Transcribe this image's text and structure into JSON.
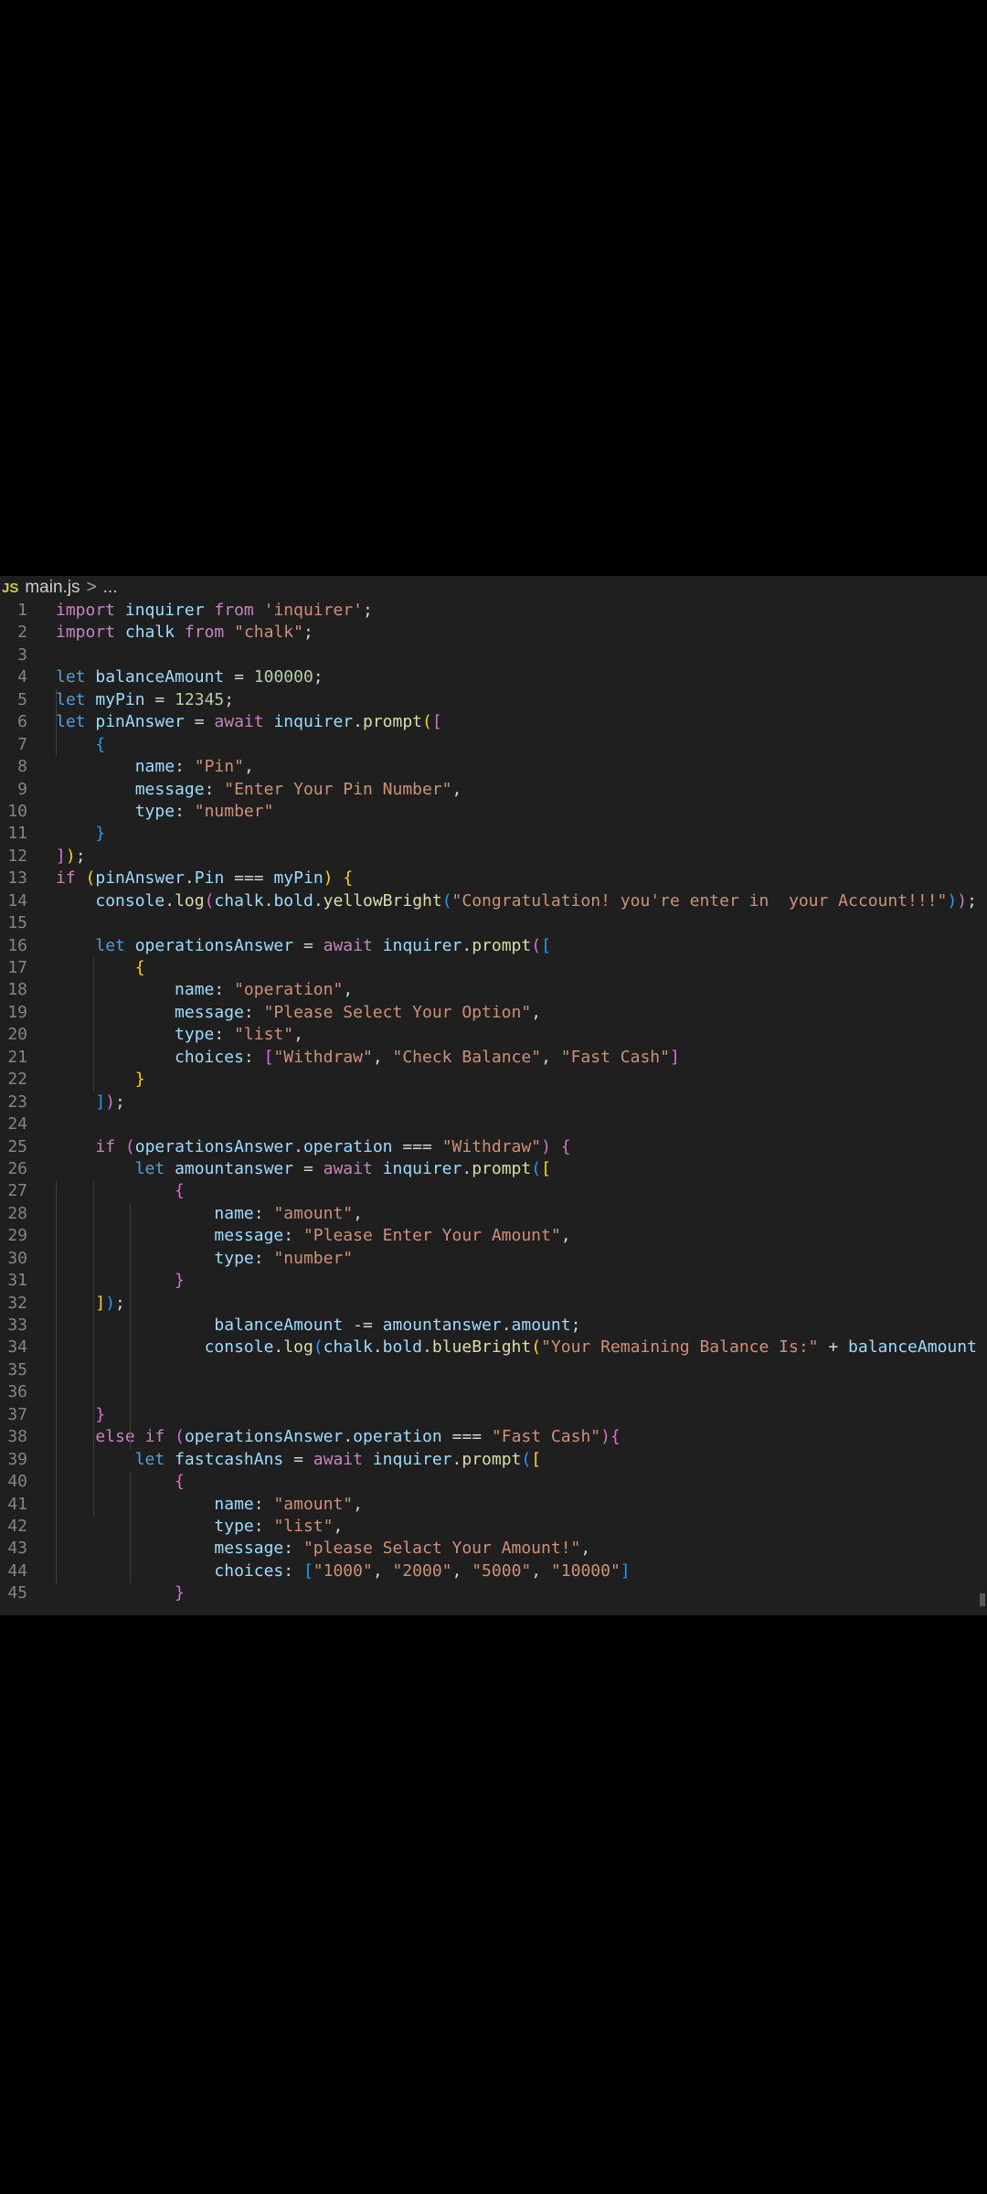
{
  "breadcrumb": {
    "file_badge": "JS",
    "file_name": "main.js",
    "separator": ">",
    "trailing": "..."
  },
  "colors": {
    "editor_background": "#1f1f1f",
    "line_number": "#858585",
    "keyword": "#569cd6",
    "control_keyword": "#c586c0",
    "variable": "#9cdcfe",
    "function": "#dcdcaa",
    "string": "#ce9178",
    "number": "#b5cea8"
  },
  "editor": {
    "lines": [
      {
        "n": "1",
        "tokens": [
          [
            "ctrl",
            "import"
          ],
          [
            "t",
            " "
          ],
          [
            "var",
            "inquirer"
          ],
          [
            "t",
            " "
          ],
          [
            "ctrl",
            "from"
          ],
          [
            "t",
            " "
          ],
          [
            "str",
            "'inquirer'"
          ],
          [
            "t",
            ";"
          ]
        ]
      },
      {
        "n": "2",
        "tokens": [
          [
            "ctrl",
            "import"
          ],
          [
            "t",
            " "
          ],
          [
            "var",
            "chalk"
          ],
          [
            "t",
            " "
          ],
          [
            "ctrl",
            "from"
          ],
          [
            "t",
            " "
          ],
          [
            "str",
            "\"chalk\""
          ],
          [
            "t",
            ";"
          ]
        ]
      },
      {
        "n": "3",
        "tokens": []
      },
      {
        "n": "4",
        "tokens": [
          [
            "kw",
            "let"
          ],
          [
            "t",
            " "
          ],
          [
            "var",
            "balanceAmount"
          ],
          [
            "t",
            " = "
          ],
          [
            "num",
            "100000"
          ],
          [
            "t",
            ";"
          ]
        ]
      },
      {
        "n": "5",
        "tokens": [
          [
            "kw",
            "let"
          ],
          [
            "t",
            " "
          ],
          [
            "var",
            "myPin"
          ],
          [
            "t",
            " = "
          ],
          [
            "num",
            "12345"
          ],
          [
            "t",
            ";"
          ]
        ]
      },
      {
        "n": "6",
        "tokens": [
          [
            "kw",
            "let"
          ],
          [
            "t",
            " "
          ],
          [
            "var",
            "pinAnswer"
          ],
          [
            "t",
            " = "
          ],
          [
            "ctrl",
            "await"
          ],
          [
            "t",
            " "
          ],
          [
            "var",
            "inquirer"
          ],
          [
            "t",
            "."
          ],
          [
            "fn",
            "prompt"
          ],
          [
            "b1",
            "("
          ],
          [
            "b2",
            "["
          ]
        ]
      },
      {
        "n": "7",
        "tokens": [
          [
            "t",
            "    "
          ],
          [
            "b3",
            "{"
          ]
        ]
      },
      {
        "n": "8",
        "tokens": [
          [
            "t",
            "        "
          ],
          [
            "var",
            "name"
          ],
          [
            "t",
            ": "
          ],
          [
            "str",
            "\"Pin\""
          ],
          [
            "t",
            ","
          ]
        ]
      },
      {
        "n": "9",
        "tokens": [
          [
            "t",
            "        "
          ],
          [
            "var",
            "message"
          ],
          [
            "t",
            ": "
          ],
          [
            "str",
            "\"Enter Your Pin Number\""
          ],
          [
            "t",
            ","
          ]
        ]
      },
      {
        "n": "10",
        "tokens": [
          [
            "t",
            "        "
          ],
          [
            "var",
            "type"
          ],
          [
            "t",
            ": "
          ],
          [
            "str",
            "\"number\""
          ]
        ]
      },
      {
        "n": "11",
        "tokens": [
          [
            "t",
            "    "
          ],
          [
            "b3",
            "}"
          ]
        ]
      },
      {
        "n": "12",
        "tokens": [
          [
            "b2",
            "]"
          ],
          [
            "b1",
            ")"
          ],
          [
            "t",
            ";"
          ]
        ]
      },
      {
        "n": "13",
        "tokens": [
          [
            "ctrl",
            "if"
          ],
          [
            "t",
            " "
          ],
          [
            "b1",
            "("
          ],
          [
            "var",
            "pinAnswer"
          ],
          [
            "t",
            "."
          ],
          [
            "var",
            "Pin"
          ],
          [
            "t",
            " === "
          ],
          [
            "var",
            "myPin"
          ],
          [
            "b1",
            ")"
          ],
          [
            "t",
            " "
          ],
          [
            "b1",
            "{"
          ]
        ]
      },
      {
        "n": "14",
        "tokens": [
          [
            "t",
            "    "
          ],
          [
            "var",
            "console"
          ],
          [
            "t",
            "."
          ],
          [
            "fn",
            "log"
          ],
          [
            "b2",
            "("
          ],
          [
            "var",
            "chalk"
          ],
          [
            "t",
            "."
          ],
          [
            "var",
            "bold"
          ],
          [
            "t",
            "."
          ],
          [
            "fn",
            "yellowBright"
          ],
          [
            "b3",
            "("
          ],
          [
            "str",
            "\"Congratulation! you're enter in  your Account!!!\""
          ],
          [
            "b3",
            ")"
          ],
          [
            "b2",
            ")"
          ],
          [
            "t",
            ";"
          ]
        ]
      },
      {
        "n": "15",
        "tokens": []
      },
      {
        "n": "16",
        "tokens": [
          [
            "t",
            "    "
          ],
          [
            "kw",
            "let"
          ],
          [
            "t",
            " "
          ],
          [
            "var",
            "operationsAnswer"
          ],
          [
            "t",
            " = "
          ],
          [
            "ctrl",
            "await"
          ],
          [
            "t",
            " "
          ],
          [
            "var",
            "inquirer"
          ],
          [
            "t",
            "."
          ],
          [
            "fn",
            "prompt"
          ],
          [
            "b2",
            "("
          ],
          [
            "b3",
            "["
          ]
        ]
      },
      {
        "n": "17",
        "tokens": [
          [
            "t",
            "        "
          ],
          [
            "b1",
            "{"
          ]
        ]
      },
      {
        "n": "18",
        "tokens": [
          [
            "t",
            "            "
          ],
          [
            "var",
            "name"
          ],
          [
            "t",
            ": "
          ],
          [
            "str",
            "\"operation\""
          ],
          [
            "t",
            ","
          ]
        ]
      },
      {
        "n": "19",
        "tokens": [
          [
            "t",
            "            "
          ],
          [
            "var",
            "message"
          ],
          [
            "t",
            ": "
          ],
          [
            "str",
            "\"Please Select Your Option\""
          ],
          [
            "t",
            ","
          ]
        ]
      },
      {
        "n": "20",
        "tokens": [
          [
            "t",
            "            "
          ],
          [
            "var",
            "type"
          ],
          [
            "t",
            ": "
          ],
          [
            "str",
            "\"list\""
          ],
          [
            "t",
            ","
          ]
        ]
      },
      {
        "n": "21",
        "tokens": [
          [
            "t",
            "            "
          ],
          [
            "var",
            "choices"
          ],
          [
            "t",
            ": "
          ],
          [
            "b2",
            "["
          ],
          [
            "str",
            "\"Withdraw\""
          ],
          [
            "t",
            ", "
          ],
          [
            "str",
            "\"Check Balance\""
          ],
          [
            "t",
            ", "
          ],
          [
            "str",
            "\"Fast Cash\""
          ],
          [
            "b2",
            "]"
          ]
        ]
      },
      {
        "n": "22",
        "tokens": [
          [
            "t",
            "        "
          ],
          [
            "b1",
            "}"
          ]
        ]
      },
      {
        "n": "23",
        "tokens": [
          [
            "t",
            "    "
          ],
          [
            "b3",
            "]"
          ],
          [
            "b2",
            ")"
          ],
          [
            "t",
            ";"
          ]
        ]
      },
      {
        "n": "24",
        "tokens": []
      },
      {
        "n": "25",
        "tokens": [
          [
            "t",
            "    "
          ],
          [
            "ctrl",
            "if"
          ],
          [
            "t",
            " "
          ],
          [
            "b2",
            "("
          ],
          [
            "var",
            "operationsAnswer"
          ],
          [
            "t",
            "."
          ],
          [
            "var",
            "operation"
          ],
          [
            "t",
            " === "
          ],
          [
            "str",
            "\"Withdraw\""
          ],
          [
            "b2",
            ")"
          ],
          [
            "t",
            " "
          ],
          [
            "b2",
            "{"
          ]
        ]
      },
      {
        "n": "26",
        "tokens": [
          [
            "t",
            "        "
          ],
          [
            "kw",
            "let"
          ],
          [
            "t",
            " "
          ],
          [
            "var",
            "amountanswer"
          ],
          [
            "t",
            " = "
          ],
          [
            "ctrl",
            "await"
          ],
          [
            "t",
            " "
          ],
          [
            "var",
            "inquirer"
          ],
          [
            "t",
            "."
          ],
          [
            "fn",
            "prompt"
          ],
          [
            "b3",
            "("
          ],
          [
            "b1",
            "["
          ]
        ]
      },
      {
        "n": "27",
        "tokens": [
          [
            "t",
            "            "
          ],
          [
            "b2",
            "{"
          ]
        ]
      },
      {
        "n": "28",
        "tokens": [
          [
            "t",
            "                "
          ],
          [
            "var",
            "name"
          ],
          [
            "t",
            ": "
          ],
          [
            "str",
            "\"amount\""
          ],
          [
            "t",
            ","
          ]
        ]
      },
      {
        "n": "29",
        "tokens": [
          [
            "t",
            "                "
          ],
          [
            "var",
            "message"
          ],
          [
            "t",
            ": "
          ],
          [
            "str",
            "\"Please Enter Your Amount\""
          ],
          [
            "t",
            ","
          ]
        ]
      },
      {
        "n": "30",
        "tokens": [
          [
            "t",
            "                "
          ],
          [
            "var",
            "type"
          ],
          [
            "t",
            ": "
          ],
          [
            "str",
            "\"number\""
          ]
        ]
      },
      {
        "n": "31",
        "tokens": [
          [
            "t",
            "            "
          ],
          [
            "b2",
            "}"
          ]
        ]
      },
      {
        "n": "32",
        "tokens": [
          [
            "t",
            "    "
          ],
          [
            "b1",
            "]"
          ],
          [
            "b3",
            ")"
          ],
          [
            "t",
            ";"
          ]
        ]
      },
      {
        "n": "33",
        "tokens": [
          [
            "t",
            "                "
          ],
          [
            "var",
            "balanceAmount"
          ],
          [
            "t",
            " -= "
          ],
          [
            "var",
            "amountanswer"
          ],
          [
            "t",
            "."
          ],
          [
            "var",
            "amount"
          ],
          [
            "t",
            ";"
          ]
        ]
      },
      {
        "n": "34",
        "tokens": [
          [
            "t",
            "               "
          ],
          [
            "var",
            "console"
          ],
          [
            "t",
            "."
          ],
          [
            "fn",
            "log"
          ],
          [
            "b3",
            "("
          ],
          [
            "var",
            "chalk"
          ],
          [
            "t",
            "."
          ],
          [
            "var",
            "bold"
          ],
          [
            "t",
            "."
          ],
          [
            "fn",
            "blueBright"
          ],
          [
            "b1",
            "("
          ],
          [
            "str",
            "\"Your Remaining Balance Is:\""
          ],
          [
            "t",
            " + "
          ],
          [
            "var",
            "balanceAmount"
          ],
          [
            "b1",
            ")"
          ],
          [
            "b3",
            ")"
          ],
          [
            "t",
            ";"
          ]
        ]
      },
      {
        "n": "35",
        "tokens": []
      },
      {
        "n": "36",
        "tokens": []
      },
      {
        "n": "37",
        "tokens": [
          [
            "t",
            "    "
          ],
          [
            "b2",
            "}"
          ]
        ]
      },
      {
        "n": "38",
        "tokens": [
          [
            "t",
            "    "
          ],
          [
            "ctrl",
            "else"
          ],
          [
            "t",
            " "
          ],
          [
            "ctrl",
            "if"
          ],
          [
            "t",
            " "
          ],
          [
            "b2",
            "("
          ],
          [
            "var",
            "operationsAnswer"
          ],
          [
            "t",
            "."
          ],
          [
            "var",
            "operation"
          ],
          [
            "t",
            " === "
          ],
          [
            "str",
            "\"Fast Cash\""
          ],
          [
            "b2",
            ")"
          ],
          [
            "b2",
            "{"
          ]
        ]
      },
      {
        "n": "39",
        "tokens": [
          [
            "t",
            "        "
          ],
          [
            "kw",
            "let"
          ],
          [
            "t",
            " "
          ],
          [
            "var",
            "fastcashAns"
          ],
          [
            "t",
            " = "
          ],
          [
            "ctrl",
            "await"
          ],
          [
            "t",
            " "
          ],
          [
            "var",
            "inquirer"
          ],
          [
            "t",
            "."
          ],
          [
            "fn",
            "prompt"
          ],
          [
            "b3",
            "("
          ],
          [
            "b1",
            "["
          ]
        ]
      },
      {
        "n": "40",
        "tokens": [
          [
            "t",
            "            "
          ],
          [
            "b2",
            "{"
          ]
        ]
      },
      {
        "n": "41",
        "tokens": [
          [
            "t",
            "                "
          ],
          [
            "var",
            "name"
          ],
          [
            "t",
            ": "
          ],
          [
            "str",
            "\"amount\""
          ],
          [
            "t",
            ","
          ]
        ]
      },
      {
        "n": "42",
        "tokens": [
          [
            "t",
            "                "
          ],
          [
            "var",
            "type"
          ],
          [
            "t",
            ": "
          ],
          [
            "str",
            "\"list\""
          ],
          [
            "t",
            ","
          ]
        ]
      },
      {
        "n": "43",
        "tokens": [
          [
            "t",
            "                "
          ],
          [
            "var",
            "message"
          ],
          [
            "t",
            ": "
          ],
          [
            "str",
            "\"please Selact Your Amount!\""
          ],
          [
            "t",
            ","
          ]
        ]
      },
      {
        "n": "44",
        "tokens": [
          [
            "t",
            "                "
          ],
          [
            "var",
            "choices"
          ],
          [
            "t",
            ": "
          ],
          [
            "b3",
            "["
          ],
          [
            "str",
            "\"1000\""
          ],
          [
            "t",
            ", "
          ],
          [
            "str",
            "\"2000\""
          ],
          [
            "t",
            ", "
          ],
          [
            "str",
            "\"5000\""
          ],
          [
            "t",
            ", "
          ],
          [
            "str",
            "\"10000\""
          ],
          [
            "b3",
            "]"
          ]
        ]
      },
      {
        "n": "45",
        "tokens": [
          [
            "t",
            "            "
          ],
          [
            "b2",
            "}"
          ]
        ]
      }
    ]
  }
}
